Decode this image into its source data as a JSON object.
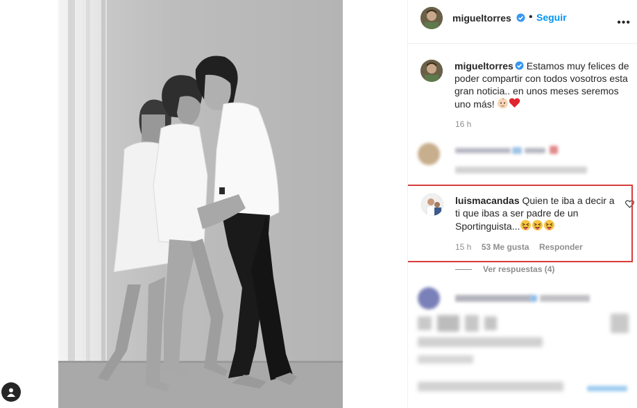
{
  "post": {
    "author": "migueltorres",
    "follow_label": "Seguir",
    "more_label": "•••",
    "caption_text": "Estamos muy felices de poder compartir con todos vosotros esta gran noticia.. en unos meses seremos uno más!",
    "caption_time": "16 h"
  },
  "highlighted_comment": {
    "username": "luismacandas",
    "text": "Quien te iba a decir a ti que ibas a ser padre de un Sportinguista...",
    "time": "15 h",
    "likes": "53 Me gusta",
    "reply_label": "Responder",
    "view_replies": "Ver respuestas (4)"
  },
  "colors": {
    "accent": "#0095f6",
    "highlight_border": "#d93a3a",
    "muted_text": "#8e8e8e"
  },
  "icons": [
    "verified-badge-icon",
    "more-options-icon",
    "heart-icon",
    "baby-emoji-icon",
    "red-heart-emoji-icon",
    "tongue-wink-emoji-icon",
    "profile-icon"
  ]
}
